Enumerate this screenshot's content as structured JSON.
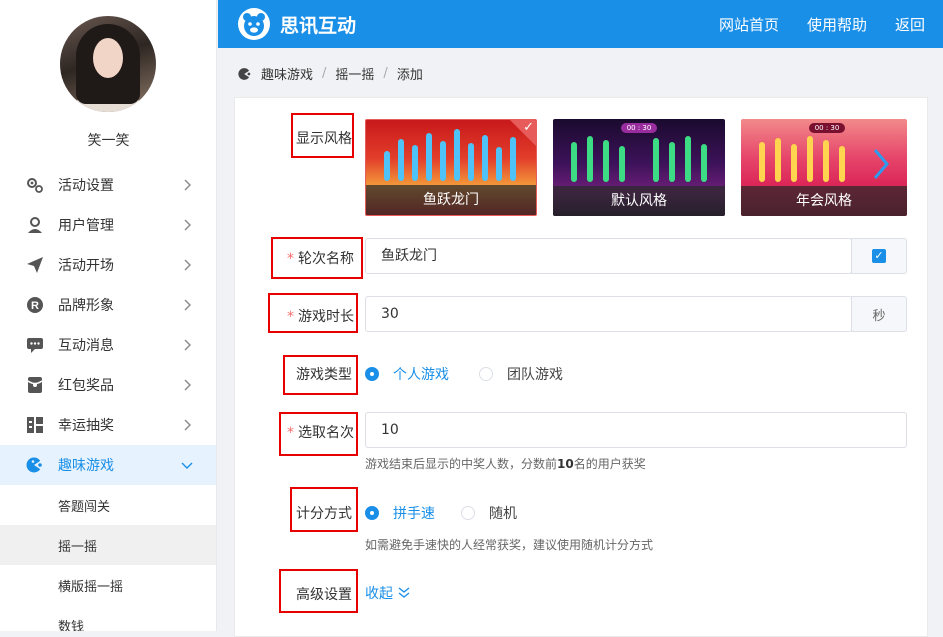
{
  "user": {
    "name": "笑一笑"
  },
  "header": {
    "brand": "思讯互动",
    "nav": [
      "网站首页",
      "使用帮助",
      "返回"
    ],
    "accent": "#1a8fe8"
  },
  "sidebar": {
    "items": [
      {
        "label": "活动设置",
        "icon": "gears-icon"
      },
      {
        "label": "用户管理",
        "icon": "user-icon"
      },
      {
        "label": "活动开场",
        "icon": "paper-plane-icon"
      },
      {
        "label": "品牌形象",
        "icon": "registered-icon"
      },
      {
        "label": "互动消息",
        "icon": "chat-icon"
      },
      {
        "label": "红包奖品",
        "icon": "red-envelope-icon"
      },
      {
        "label": "幸运抽奖",
        "icon": "lottery-icon"
      },
      {
        "label": "趣味游戏",
        "icon": "game-icon",
        "active": true
      }
    ],
    "sub_items": [
      "答题闯关",
      "摇一摇",
      "横版摇一摇",
      "数钱"
    ],
    "selected_sub": "摇一摇"
  },
  "breadcrumb": [
    "趣味游戏",
    "摇一摇",
    "添加"
  ],
  "form": {
    "style_label": "显示风格",
    "styles": [
      {
        "name": "鱼跃龙门",
        "selected": true
      },
      {
        "name": "默认风格"
      },
      {
        "name": "年会风格"
      }
    ],
    "round_label": "轮次名称",
    "round_value": "鱼跃龙门",
    "duration_label": "游戏时长",
    "duration_value": "30",
    "duration_unit": "秒",
    "type_label": "游戏类型",
    "type_options": [
      "个人游戏",
      "团队游戏"
    ],
    "type_selected": "个人游戏",
    "rank_label": "选取名次",
    "rank_value": "10",
    "rank_hint_prefix": "游戏结束后显示的中奖人数，分数前",
    "rank_hint_num": "10",
    "rank_hint_suffix": "名的用户获奖",
    "score_label": "计分方式",
    "score_options": [
      "拼手速",
      "随机"
    ],
    "score_selected": "拼手速",
    "score_hint": "如需避免手速快的人经常获奖，建议使用随机计分方式",
    "advanced_label": "高级设置",
    "collapse_label": "收起"
  },
  "card2_clock": "00 : 30",
  "card3_clock": "00 : 30"
}
